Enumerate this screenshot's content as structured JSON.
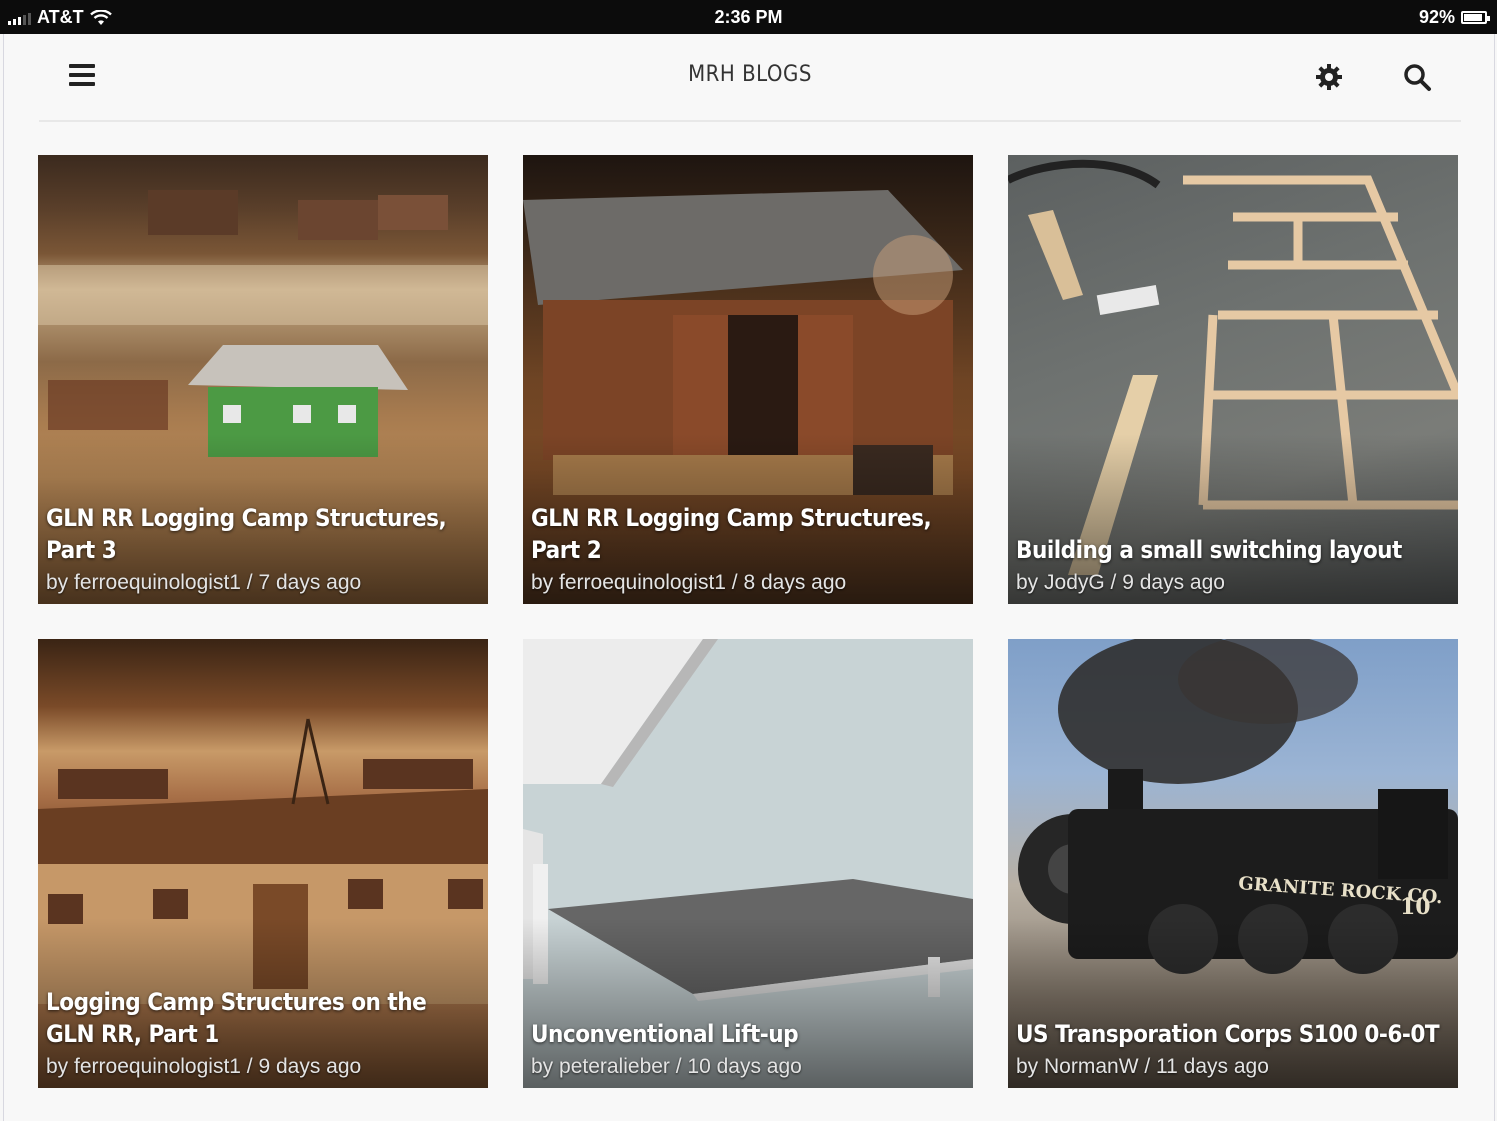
{
  "status_bar": {
    "carrier": "AT&T",
    "time": "2:36 PM",
    "battery": "92%"
  },
  "header": {
    "title": "MRH BLOGS"
  },
  "icons": {
    "menu": "hamburger-menu-icon",
    "settings": "gear-icon",
    "search": "magnifier-icon",
    "wifi": "wifi-icon",
    "signal": "signal-bars-icon",
    "battery": "battery-icon"
  },
  "posts": [
    {
      "title": "GLN RR Logging Camp Structures, Part 3",
      "byline": "by ferroequinologist1 / 7 days ago",
      "thumbnail": "logging camp model with green cabin and log piles"
    },
    {
      "title": "GLN RR Logging Camp Structures, Part 2",
      "byline": "by ferroequinologist1 / 8 days ago",
      "thumbnail": "wooden shed model with barrels and cylinders"
    },
    {
      "title": "Building a small switching layout",
      "byline": "by JodyG / 9 days ago",
      "thumbnail": "wooden benchwork frame on garage floor"
    },
    {
      "title": "Logging Camp Structures on the GLN RR, Part 1",
      "byline": "by ferroequinologist1 / 9 days ago",
      "thumbnail": "long wooden bunkhouse model with log piles"
    },
    {
      "title": "Unconventional Lift-up",
      "byline": "by peteralieber / 10 days ago",
      "thumbnail": "3D render of grey lift-up panel"
    },
    {
      "title": "US Transporation Corps S100 0-6-0T",
      "byline": "by NormanW / 11 days ago",
      "thumbnail": "steam locomotive Granite Rock Co 10 with smoke"
    }
  ],
  "colors": {
    "status_bar_bg": "#0c0c0c",
    "app_bg": "#f8f8f8",
    "title_text": "#333333"
  }
}
